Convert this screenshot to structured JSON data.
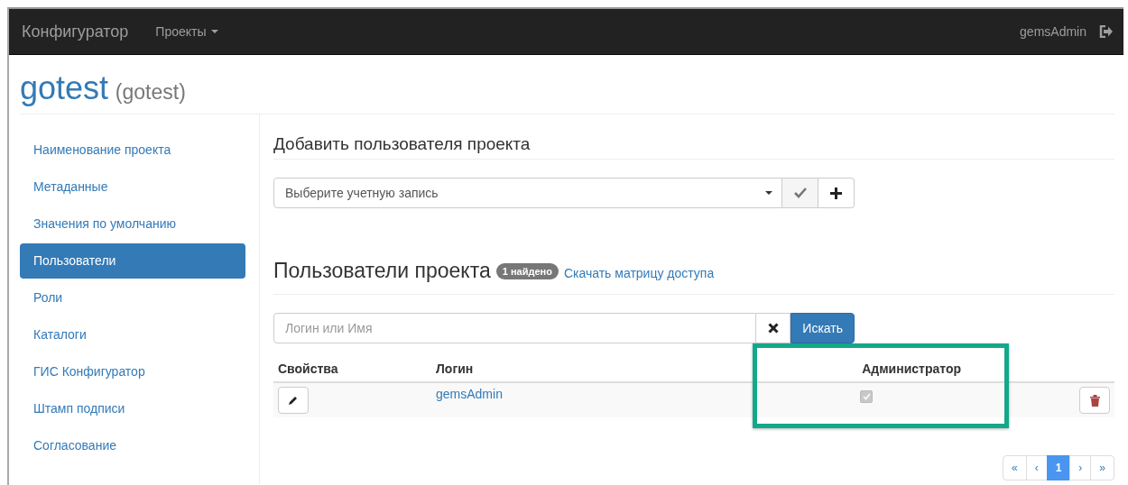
{
  "navbar": {
    "brand": "Конфигуратор",
    "menu": {
      "label": "Проекты"
    },
    "user": "gemsAdmin"
  },
  "page_title": {
    "name": "gotest",
    "code": "(gotest)"
  },
  "sidebar": {
    "items": [
      {
        "label": "Наименование проекта",
        "selected": false
      },
      {
        "label": "Метаданные",
        "selected": false
      },
      {
        "label": "Значения по умолчанию",
        "selected": false
      },
      {
        "label": "Пользователи",
        "selected": true
      },
      {
        "label": "Роли",
        "selected": false
      },
      {
        "label": "Каталоги",
        "selected": false
      },
      {
        "label": "ГИС Конфигуратор",
        "selected": false
      },
      {
        "label": "Штамп подписи",
        "selected": false
      },
      {
        "label": "Согласование",
        "selected": false
      }
    ]
  },
  "add_user": {
    "heading": "Добавить пользователя проекта",
    "select": {
      "placeholder": "Выберите учетную запись"
    }
  },
  "users": {
    "heading": "Пользователи проекта",
    "badge": "1 найдено",
    "link": "Скачать матрицу доступа",
    "search": {
      "placeholder": "Логин или Имя",
      "button": "Искать"
    },
    "columns": [
      "Свойства",
      "Логин",
      "Администратор"
    ],
    "rows": [
      {
        "login": "gemsAdmin",
        "admin": true
      }
    ],
    "highlight_column": true
  },
  "pagination": [
    {
      "label": "«",
      "selected": false
    },
    {
      "label": "‹",
      "selected": false
    },
    {
      "label": "1",
      "selected": true
    },
    {
      "label": "›",
      "selected": false
    },
    {
      "label": "»",
      "selected": false
    }
  ]
}
